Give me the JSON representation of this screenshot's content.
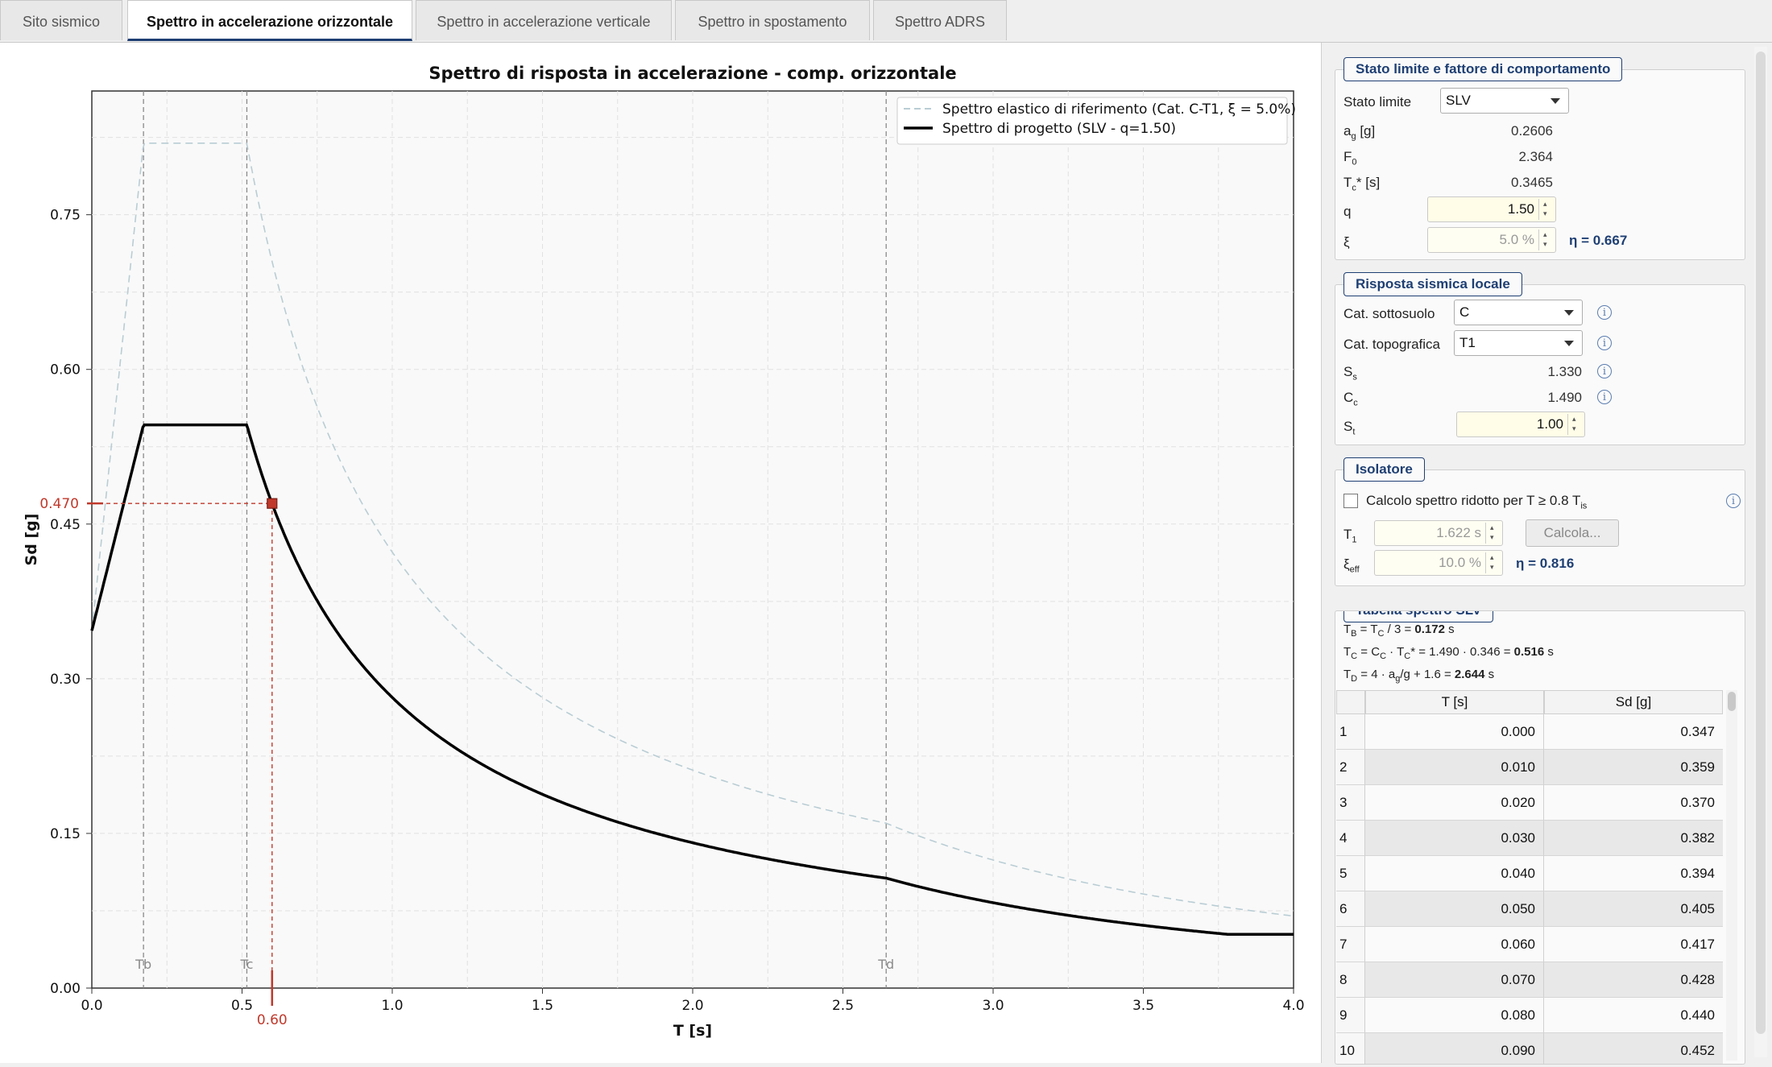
{
  "tabs": [
    {
      "label": "Sito sismico",
      "active": false
    },
    {
      "label": "Spettro in accelerazione orizzontale",
      "active": true
    },
    {
      "label": "Spettro in accelerazione verticale",
      "active": false
    },
    {
      "label": "Spettro in spostamento",
      "active": false
    },
    {
      "label": "Spettro ADRS",
      "active": false
    }
  ],
  "chart_data": {
    "type": "line",
    "title": "Spettro di risposta in accelerazione - comp. orizzontale",
    "xlabel": "T [s]",
    "ylabel": "Sd [g]",
    "xlim": [
      0,
      4.0
    ],
    "ylim": [
      0,
      0.87
    ],
    "xticks": [
      "0.0",
      "0.5",
      "1.0",
      "1.5",
      "2.0",
      "2.5",
      "3.0",
      "3.5",
      "4.0"
    ],
    "yticks": [
      "0.00",
      "0.15",
      "0.30",
      "0.45",
      "0.60",
      "0.75"
    ],
    "grid": true,
    "legend_position": "top-right",
    "params": {
      "ag": 0.2606,
      "F0": 2.364,
      "S": 1.33,
      "q": 1.5,
      "TB": 0.172,
      "TC": 0.516,
      "TD": 2.644,
      "eta_elastic": 1.0,
      "min_design": 0.0521
    },
    "series": [
      {
        "name": "Spettro elastico di riferimento (Cat. C-T1, ξ = 5.0%)",
        "style": "dashed",
        "color": "#b9cdd4"
      },
      {
        "name": "Spettro di progetto (SLV - q=1.50)",
        "style": "solid",
        "color": "#000000"
      }
    ],
    "vlines": [
      {
        "x": 0.172,
        "label": "Tb"
      },
      {
        "x": 0.516,
        "label": "Tc"
      },
      {
        "x": 2.644,
        "label": "Td"
      }
    ],
    "marker": {
      "x": 0.6,
      "y": 0.47,
      "x_label": "0.60",
      "y_label": "0.470",
      "color": "#c0392b"
    }
  },
  "panel": {
    "stato": {
      "title": "Stato limite e fattore di comportamento",
      "stato_limite_label": "Stato limite",
      "stato_limite_value": "SLV",
      "ag_label": "a",
      "ag_sub": "g",
      "ag_unit": " [g]",
      "ag_value": "0.2606",
      "F0_label": "F",
      "F0_sub": "0",
      "F0_value": "2.364",
      "Tc_label": "T",
      "Tc_sub": "c",
      "Tc_unit": "* [s]",
      "Tc_value": "0.3465",
      "q_label": "q",
      "q_value": "1.50",
      "xi_label": "ξ",
      "xi_value": "5.0 %",
      "eta": "η = 0.667"
    },
    "risposta": {
      "title": "Risposta sismica locale",
      "cat_sottosuolo_label": "Cat. sottosuolo",
      "cat_sottosuolo_value": "C",
      "cat_topografica_label": "Cat. topografica",
      "cat_topografica_value": "T1",
      "Ss_label": "S",
      "Ss_sub": "s",
      "Ss_value": "1.330",
      "Cc_label": "C",
      "Cc_sub": "c",
      "Cc_value": "1.490",
      "St_label": "S",
      "St_sub": "t",
      "St_value": "1.00"
    },
    "isolatore": {
      "title": "Isolatore",
      "checkbox_label": "Calcolo spettro ridotto per T ≥ 0.8 T",
      "checkbox_sub": "is",
      "checked": false,
      "T1_label": "T",
      "T1_sub": "1",
      "T1_value": "1.622 s",
      "calcola_label": "Calcola...",
      "xi_eff_label": "ξ",
      "xi_eff_sub": "eff",
      "xi_eff_value": "10.0 %",
      "eta": "η = 0.816"
    },
    "tabella": {
      "title": "Tabella spettro SLV",
      "formula_tb_pre": "T",
      "formula_tb_sub": "B",
      "formula_tb_mid": " = T",
      "formula_tb_sub2": "C",
      "formula_tb_post": " / 3 = ",
      "formula_tb_val": "0.172",
      "formula_tb_unit": " s",
      "formula_tc_pre": "T",
      "formula_tc_sub": "C",
      "formula_tc_mid": " = C",
      "formula_tc_sub2": "C",
      "formula_tc_mid2": " · T",
      "formula_tc_sub3": "C",
      "formula_tc_post": "* = 1.490 · 0.346 = ",
      "formula_tc_val": "0.516",
      "formula_tc_unit": " s",
      "formula_td_pre": "T",
      "formula_td_sub": "D",
      "formula_td_mid": " = 4 · a",
      "formula_td_sub2": "g",
      "formula_td_post": "/g + 1.6 = ",
      "formula_td_val": "2.644",
      "formula_td_unit": " s",
      "col_T": "T [s]",
      "col_Sd": "Sd [g]",
      "rows": [
        {
          "i": "1",
          "T": "0.000",
          "Sd": "0.347"
        },
        {
          "i": "2",
          "T": "0.010",
          "Sd": "0.359"
        },
        {
          "i": "3",
          "T": "0.020",
          "Sd": "0.370"
        },
        {
          "i": "4",
          "T": "0.030",
          "Sd": "0.382"
        },
        {
          "i": "5",
          "T": "0.040",
          "Sd": "0.394"
        },
        {
          "i": "6",
          "T": "0.050",
          "Sd": "0.405"
        },
        {
          "i": "7",
          "T": "0.060",
          "Sd": "0.417"
        },
        {
          "i": "8",
          "T": "0.070",
          "Sd": "0.428"
        },
        {
          "i": "9",
          "T": "0.080",
          "Sd": "0.440"
        },
        {
          "i": "10",
          "T": "0.090",
          "Sd": "0.452"
        }
      ]
    }
  }
}
